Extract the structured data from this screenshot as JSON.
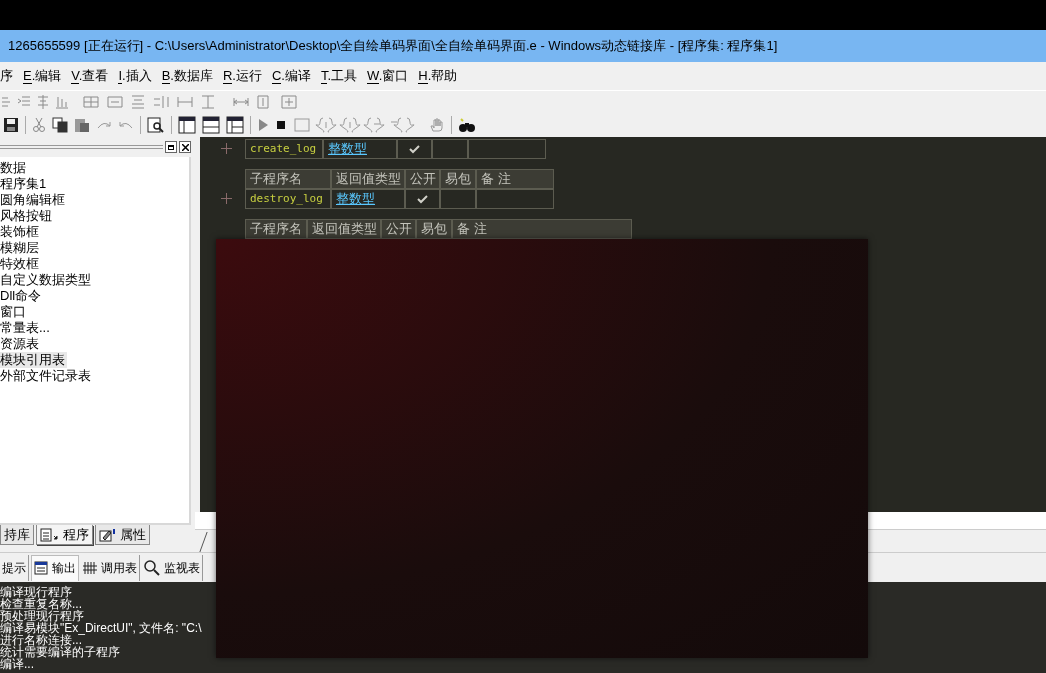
{
  "window": {
    "title": "1265655599 [正在运行] - C:\\Users\\Administrator\\Desktop\\全自绘单码界面\\全自绘单码界面.e - Windows动态链接库 - [程序集: 程序集1]"
  },
  "menu": [
    {
      "rest": "序"
    },
    {
      "accel": "E",
      "rest": ".编辑"
    },
    {
      "accel": "V",
      "rest": ".查看"
    },
    {
      "accel": "I",
      "rest": ".插入"
    },
    {
      "accel": "B",
      "rest": ".数据库"
    },
    {
      "accel": "R",
      "rest": ".运行"
    },
    {
      "accel": "C",
      "rest": ".编译"
    },
    {
      "accel": "T",
      "rest": ".工具"
    },
    {
      "accel": "W",
      "rest": ".窗口"
    },
    {
      "accel": "H",
      "rest": ".帮助"
    }
  ],
  "tree": {
    "items": [
      {
        "label": "数据",
        "selected": false
      },
      {
        "label": "程序集1",
        "selected": false
      },
      {
        "label": "圆角编辑框",
        "selected": false
      },
      {
        "label": "风格按钮",
        "selected": false
      },
      {
        "label": "装饰框",
        "selected": false
      },
      {
        "label": "模糊层",
        "selected": false
      },
      {
        "label": "特效框",
        "selected": false
      },
      {
        "label": "自定义数据类型",
        "selected": false
      },
      {
        "label": "Dll命令",
        "selected": false
      },
      {
        "label": "窗口",
        "selected": false
      },
      {
        "label": "常量表...",
        "selected": false
      },
      {
        "label": "资源表",
        "selected": false
      },
      {
        "label": "模块引用表",
        "selected": true
      },
      {
        "label": "外部文件记录表",
        "selected": false
      }
    ]
  },
  "panel_tabs": [
    {
      "label": "持库",
      "selected": false
    },
    {
      "label": "程序",
      "selected": true
    },
    {
      "label": "属性",
      "selected": false
    }
  ],
  "code_tables": [
    {
      "rows": [
        {
          "name": "create_log",
          "type": "整数型",
          "public": true,
          "ebao": false
        }
      ]
    },
    {
      "header": [
        "子程序名",
        "返回值类型",
        "公开",
        "易包",
        "备 注"
      ],
      "rows": [
        {
          "name": "destroy_log",
          "type": "整数型",
          "public": true,
          "ebao": false
        }
      ]
    },
    {
      "header": [
        "子程序名",
        "返回值类型",
        "公开",
        "易包",
        "备 注"
      ]
    }
  ],
  "output_tabs": [
    {
      "label": "提示",
      "selected": false
    },
    {
      "label": "输出",
      "selected": true
    },
    {
      "label": "调用表",
      "selected": false
    },
    {
      "label": "监视表",
      "selected": false
    }
  ],
  "output_lines": [
    "编译现行程序",
    "检查重复名称...",
    "预处理现行程序",
    "编译易模块\"Ex_DirectUI\", 文件名: \"C:\\",
    "进行名称连接...",
    "统计需要编译的子程序",
    "编译..."
  ]
}
